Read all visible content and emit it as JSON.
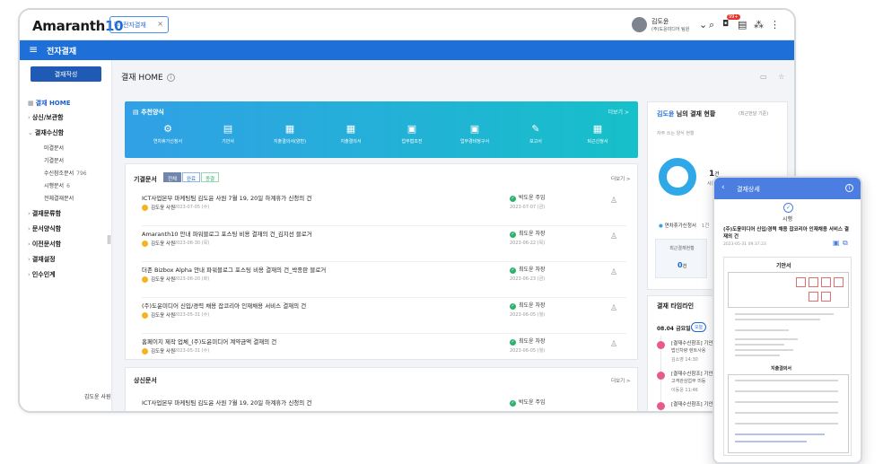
{
  "app": {
    "logo_main": "Amaranth",
    "logo_suffix": "10",
    "open_tab": "전자결재",
    "open_tab_close": "×",
    "module_title": "전자결재"
  },
  "user": {
    "name": "김도윤",
    "org": "(주)도윤미디어 팀원"
  },
  "topbar_icons": [
    "search-icon",
    "bell-icon",
    "document-icon",
    "org-chart-icon",
    "more-vertical-icon"
  ],
  "topbar_icon_glyphs": {
    "search": "⌕",
    "bell": "🔔",
    "doc": "▤",
    "org": "⁂",
    "more": "⋮"
  },
  "notification_badge": "99+",
  "sidebar": {
    "write_button": "결재작성",
    "items": [
      {
        "label": "결재 HOME",
        "active": true
      },
      {
        "label": "상신/보관함"
      },
      {
        "label": "결재수신함",
        "open": true
      },
      {
        "label": "결재문류함"
      },
      {
        "label": "문서양식함"
      },
      {
        "label": "이전문서함"
      },
      {
        "label": "결재설정"
      },
      {
        "label": "인수인계"
      }
    ],
    "subitems": [
      {
        "label": "미결문서",
        "count": ""
      },
      {
        "label": "기결문서",
        "count": ""
      },
      {
        "label": "수신참조문서",
        "count": "796"
      },
      {
        "label": "시행문서",
        "count": "6"
      },
      {
        "label": "전체결재문서",
        "count": ""
      }
    ],
    "footer_user": "김도윤 사원"
  },
  "page": {
    "title": "결재 HOME",
    "info": "i",
    "tools": "▭ ☆"
  },
  "recommended": {
    "title": "추천양식",
    "more": "더보기 >",
    "items": [
      {
        "label": "연차휴가신청서",
        "icon": "⚙"
      },
      {
        "label": "기안서",
        "icon": "▤"
      },
      {
        "label": "지출결의서(양반)",
        "icon": "▦"
      },
      {
        "label": "지출결의서",
        "icon": "▦"
      },
      {
        "label": "업무협조전",
        "icon": "▣"
      },
      {
        "label": "업무경비청구서",
        "icon": "▣"
      },
      {
        "label": "보고서",
        "icon": "✎"
      },
      {
        "label": "퇴근신청서",
        "icon": "▦"
      }
    ]
  },
  "completed": {
    "title": "기결문서",
    "filters": [
      "전체",
      "완료",
      "종결"
    ],
    "more": "더보기 >",
    "rows": [
      {
        "title": "ICT사업본부 마케팅팀 김도윤 사원 7월 19, 20일 하계휴가 신청의 건",
        "author": "김도윤 사원",
        "date": "2023-07-05 (수)",
        "status": "박도윤 주임",
        "status_date": "2023-07-07 (금)"
      },
      {
        "title": "Amaranth10 안내 파워블로그 포스팅 비용 결재의 건_김지선 블로거",
        "author": "김도윤 사원",
        "date": "2023-06-30 (목)",
        "status": "최도윤 차장",
        "status_date": "2023-06-22 (목)"
      },
      {
        "title": "더존 Bizbox Alpha 안내 파워블로그 포스팅 비용 결재의 건_박종판 블로거",
        "author": "김도윤 사원",
        "date": "2023-06-20 (화)",
        "status": "최도윤 차장",
        "status_date": "2023-06-23 (금)"
      },
      {
        "title": "(주)도윤미디어 신입/경력 채용 잡코리아 인재채용 서비스 결재의 건",
        "author": "김도윤 사원",
        "date": "2023-05-31 (수)",
        "status": "최도윤 차장",
        "status_date": "2023-06-05 (월)"
      },
      {
        "title": "홈페이지 제작 업체_(주)도윤미디어 계약금액 결재의 건",
        "author": "김도윤 사원",
        "date": "2023-05-31 (수)",
        "status": "최도윤 차장",
        "status_date": "2023-06-05 (월)"
      }
    ]
  },
  "submitted": {
    "title": "상신문서",
    "more": "더보기 >",
    "rows": [
      {
        "title": "ICT사업본부 마케팅팀 김도윤 사원 7월 19, 20일 하계휴가 신청의 건",
        "status": "박도윤 주임"
      }
    ]
  },
  "status_panel": {
    "name": "김도윤",
    "title_suffix": "님의 결재 현황",
    "period": "(최근한달 기준)",
    "sub": "자주 쓰는 양식 현황",
    "count": "1",
    "count_unit": "건",
    "count_label": "사용중",
    "legend": "연차휴가신청서",
    "legend_count": "1건",
    "card1_label": "최근결재현황",
    "card1_value": "0",
    "card1_unit": "건",
    "card2_value": "1"
  },
  "timeline": {
    "title": "결재 타임라인",
    "date": "08.04 금요일",
    "badge": "오늘",
    "items": [
      {
        "title": "[결재수신참조] 기안",
        "desc": "법인차량 렌트사용",
        "meta": "김소영",
        "time": "14:30"
      },
      {
        "title": "[결재수신참조] 기안",
        "desc": "고객관심업무 미등",
        "meta": "이동윤",
        "time": "11:46"
      },
      {
        "title": "[결재수신참조] 기안",
        "desc": "",
        "meta": "",
        "time": ""
      }
    ]
  },
  "mobile": {
    "header": "결재상세",
    "status": "시행",
    "doc_title": "(주)도윤미디어 신입/경력 채용 잡코리아 인재채용 서비스 결재의 건",
    "doc_meta": "2023-05-31 09:37:23",
    "sheet_title": "기안서",
    "sheet_title2": "지출결의서"
  },
  "colors": {
    "accent": "#1f6fd8",
    "dark_blue": "#1f5bb5",
    "ok": "#2bb26a",
    "gradient_start": "#31a0e6",
    "gradient_end": "#16c0c9"
  }
}
